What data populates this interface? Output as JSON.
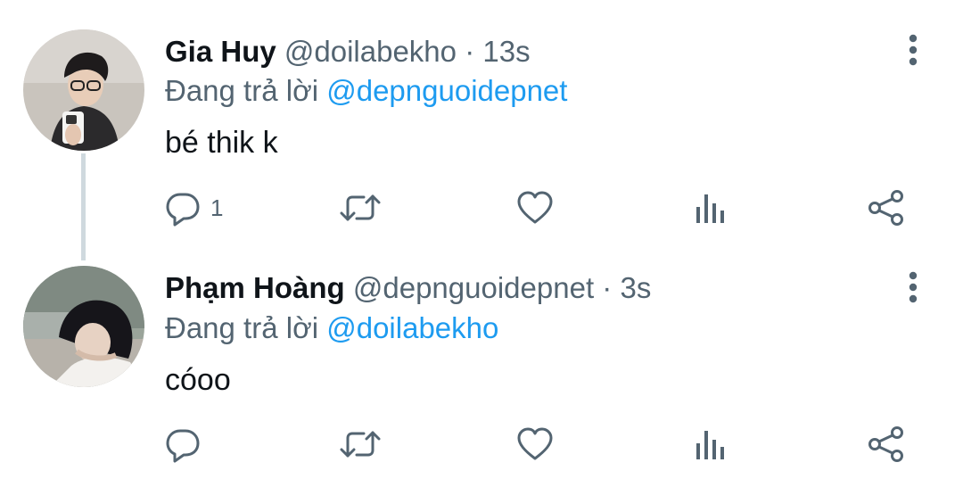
{
  "colors": {
    "text_primary": "#0f1419",
    "text_secondary": "#536471",
    "accent": "#1d9bf0",
    "thread_line": "#cfd9de",
    "icon": "#536471"
  },
  "tweets": [
    {
      "avatar_icon": "user-avatar",
      "name": "Gia Huy",
      "handle": "@doilabekho",
      "separator": "·",
      "time": "13s",
      "replying_prefix": "Đang trả lời",
      "replying_to": "@depnguoidepnet",
      "text": "bé thik k",
      "actions": {
        "reply_icon": "reply-icon",
        "reply_count": "1",
        "retweet_icon": "retweet-icon",
        "like_icon": "heart-icon",
        "views_icon": "views-icon",
        "share_icon": "share-icon"
      },
      "more_icon": "more-vertical-icon"
    },
    {
      "avatar_icon": "user-avatar",
      "name": "Phạm Hoàng",
      "handle": "@depnguoidepnet",
      "separator": "·",
      "time": "3s",
      "replying_prefix": "Đang trả lời",
      "replying_to": "@doilabekho",
      "text": "cóoo",
      "actions": {
        "reply_icon": "reply-icon",
        "reply_count": "",
        "retweet_icon": "retweet-icon",
        "like_icon": "heart-icon",
        "views_icon": "views-icon",
        "share_icon": "share-icon"
      },
      "more_icon": "more-vertical-icon"
    }
  ]
}
